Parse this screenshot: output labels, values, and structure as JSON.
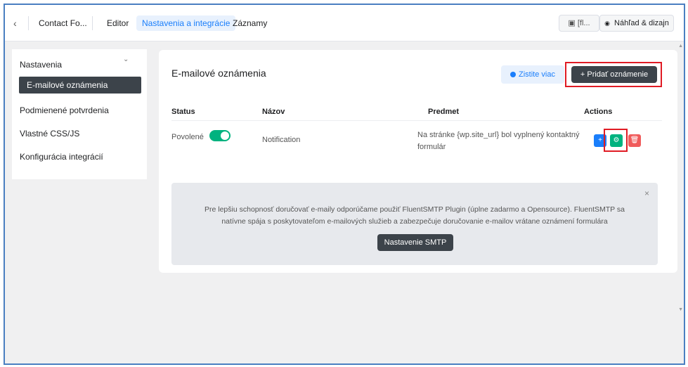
{
  "header": {
    "back_icon": "‹",
    "form_title": "Contact Fo...",
    "tabs": [
      {
        "label": "Editor"
      },
      {
        "label": "Nastavenia a integrácie"
      },
      {
        "label": "Záznamy"
      }
    ],
    "shortcode_label": "[fl...",
    "preview_label": "Náhľad & dizajn"
  },
  "sidebar": {
    "items": [
      {
        "label": "Nastavenia"
      },
      {
        "label": "E-mailové oznámenia"
      },
      {
        "label": "Podmienené potvrdenia"
      },
      {
        "label": "Vlastné CSS/JS"
      },
      {
        "label": "Konfigurácia integrácií"
      }
    ]
  },
  "card": {
    "title": "E-mailové oznámenia",
    "learn_more_label": "Zistite viac",
    "add_label": "+ Pridať oznámenie",
    "columns": [
      "Status",
      "Názov",
      "Predmet",
      "Actions"
    ],
    "rows": [
      {
        "status": "Povolené",
        "enabled": true,
        "name": "Notification",
        "subject": "Na stránke {wp.site_url} bol vyplnený kontaktný formulár"
      }
    ]
  },
  "notice": {
    "text": "Pre lepšiu schopnosť doručovať e-maily odporúčame použiť FluentSMTP Plugin (úplne zadarmo a Opensource). FluentSMTP sa natívne spája s poskytovateľom e-mailových služieb a zabezpečuje doručovanie e-mailov vrátane oznámení formulára",
    "button_label": "Nastavenie SMTP",
    "close_icon": "×"
  },
  "colors": {
    "accent": "#1a7efb",
    "success": "#00b27f",
    "danger": "#f05b5b",
    "dark_button": "#3c434a",
    "highlight_box": "#e01b24"
  }
}
